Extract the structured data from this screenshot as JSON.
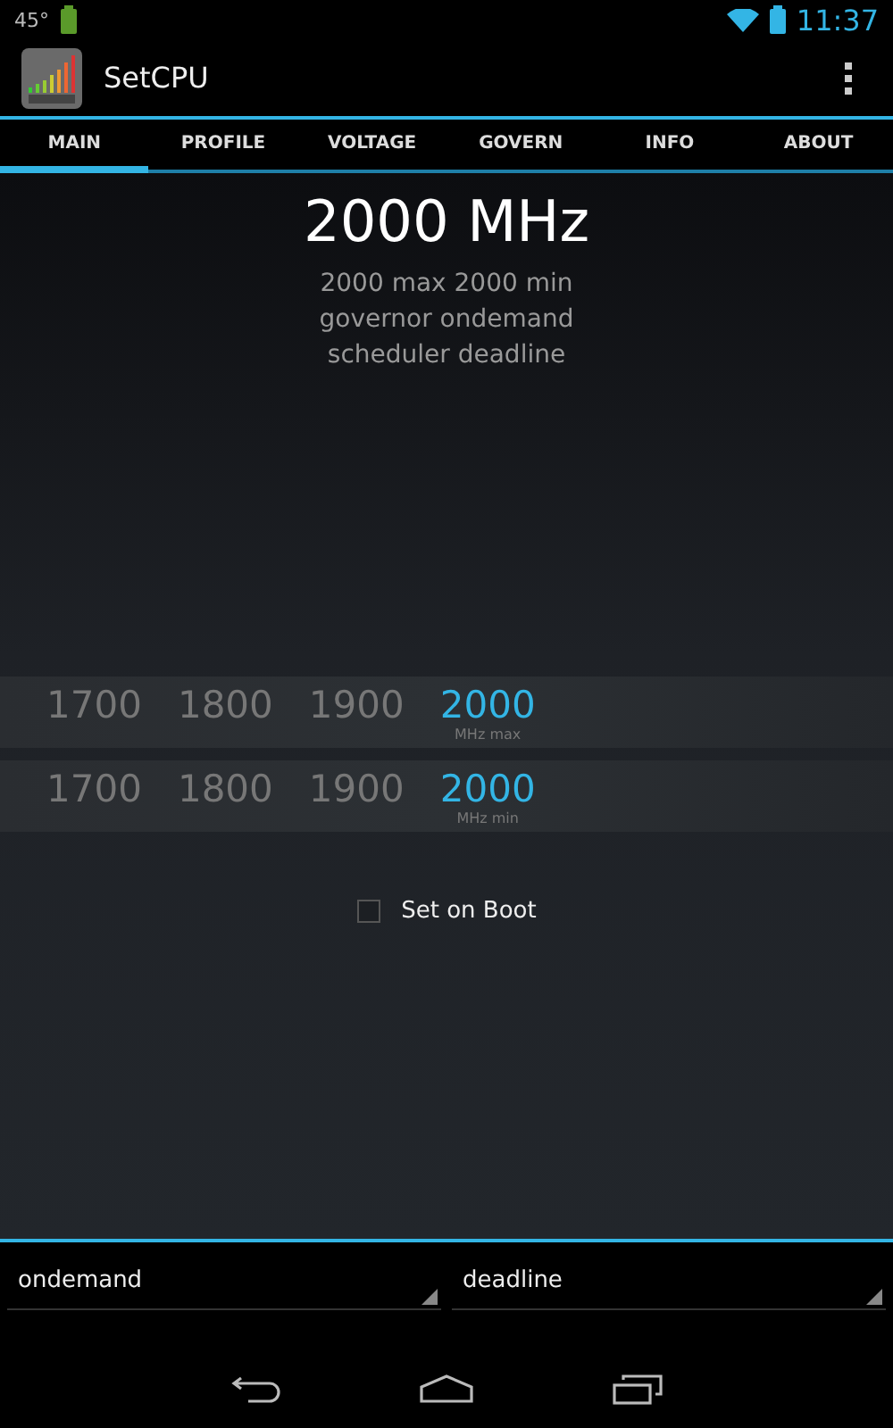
{
  "status_bar": {
    "temperature": "45°",
    "time": "11:37"
  },
  "app_bar": {
    "title": "SetCPU"
  },
  "tabs": [
    {
      "label": "MAIN",
      "selected": true
    },
    {
      "label": "PROFILE",
      "selected": false
    },
    {
      "label": "VOLTAGE",
      "selected": false
    },
    {
      "label": "GOVERN",
      "selected": false
    },
    {
      "label": "INFO",
      "selected": false
    },
    {
      "label": "ABOUT",
      "selected": false
    }
  ],
  "summary": {
    "frequency": "2000 MHz",
    "lines": [
      "2000 max 2000 min",
      "governor ondemand",
      "scheduler deadline"
    ]
  },
  "pickers": [
    {
      "unit": "MHz max",
      "values": [
        {
          "label": "1700",
          "selected": false
        },
        {
          "label": "1800",
          "selected": false
        },
        {
          "label": "1900",
          "selected": false
        },
        {
          "label": "2000",
          "selected": true
        }
      ]
    },
    {
      "unit": "MHz min",
      "values": [
        {
          "label": "1700",
          "selected": false
        },
        {
          "label": "1800",
          "selected": false
        },
        {
          "label": "1900",
          "selected": false
        },
        {
          "label": "2000",
          "selected": true
        }
      ]
    }
  ],
  "set_on_boot": {
    "label": "Set on Boot",
    "checked": false
  },
  "spinners": [
    {
      "value": "ondemand"
    },
    {
      "value": "deadline"
    }
  ]
}
